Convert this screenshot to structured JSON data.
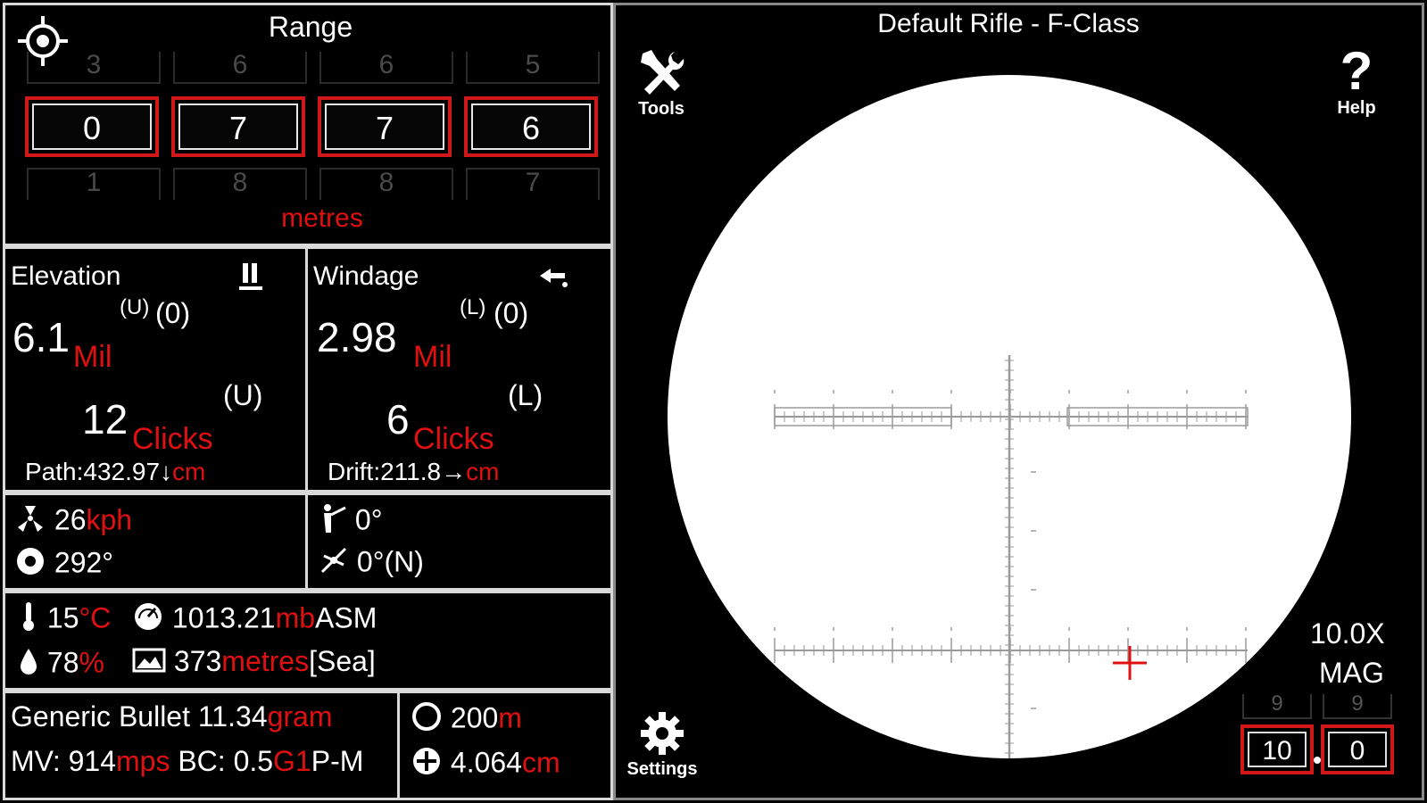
{
  "range": {
    "title": "Range",
    "above": [
      "3",
      "6",
      "6",
      "5"
    ],
    "digits": [
      "0",
      "7",
      "7",
      "6"
    ],
    "below": [
      "1",
      "8",
      "8",
      "7"
    ],
    "unit": "metres"
  },
  "elevation": {
    "title": "Elevation",
    "mil_value": "6.1",
    "mil_unit": "Mil",
    "mil_dir": "(U)",
    "mil_adj": "(0)",
    "clicks_value": "12",
    "clicks_unit": "Clicks",
    "clicks_dir": "(U)",
    "path_label": "Path:432.97↓",
    "path_unit": "cm"
  },
  "windage": {
    "title": "Windage",
    "mil_value": "2.98",
    "mil_unit": "Mil",
    "mil_dir": "(L)",
    "mil_adj": "(0)",
    "clicks_value": "6",
    "clicks_unit": "Clicks",
    "clicks_dir": "(L)",
    "drift_label": "Drift:211.8→",
    "drift_unit": "cm"
  },
  "wind": {
    "speed": "26",
    "speed_unit": "kph",
    "direction": "292°",
    "incline": "0°",
    "cant": "0°(N)"
  },
  "atmosphere": {
    "temp": "15",
    "temp_unit": "°C",
    "pressure": "1013.21",
    "pressure_unit": "mb",
    "pressure_mode": "ASM",
    "humidity": "78",
    "humidity_unit": "%",
    "altitude": "373",
    "altitude_unit": "metres",
    "altitude_mode": "[Sea]"
  },
  "bullet": {
    "name": "Generic Bullet",
    "weight": "11.34",
    "weight_unit": "gram",
    "mv_label": "MV: 914",
    "mv_unit": "mps",
    "bc_label": "BC: 0.5",
    "bc_model": "G1",
    "bc_extra": "P-M"
  },
  "zero": {
    "zero_range": "200",
    "zero_unit": "m",
    "sight_height": "4.064",
    "sight_unit": "cm"
  },
  "scope": {
    "title": "Default Rifle - F-Class",
    "tools_label": "Tools",
    "help_label": "Help",
    "settings_label": "Settings",
    "mag_value": "10.0X",
    "mag_label": "MAG",
    "mag_ghost_top": [
      "9",
      "9"
    ],
    "mag_digits": [
      "10",
      "0"
    ]
  }
}
